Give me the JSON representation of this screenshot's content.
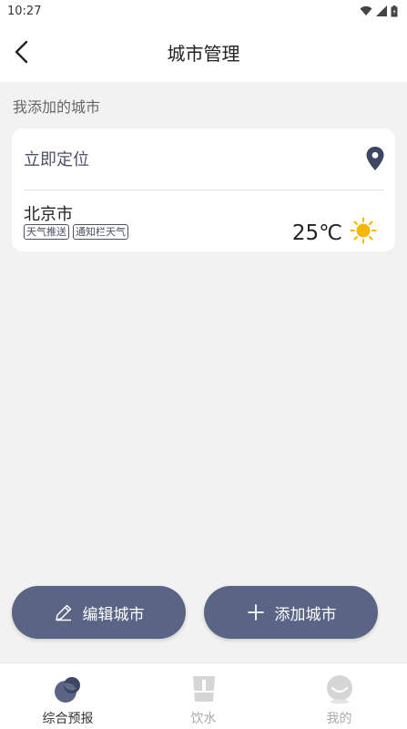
{
  "status": {
    "time": "10:27"
  },
  "header": {
    "title": "城市管理"
  },
  "section_label": "我添加的城市",
  "locate": {
    "label": "立即定位"
  },
  "city": {
    "name": "北京市",
    "tags": [
      "天气推送",
      "通知栏天气"
    ],
    "temperature": "25℃"
  },
  "actions": {
    "edit_label": "编辑城市",
    "add_label": "添加城市"
  },
  "tabs": [
    {
      "label": "综合预报",
      "icon": "forecast-icon",
      "active": true
    },
    {
      "label": "饮水",
      "icon": "water-icon",
      "active": false
    },
    {
      "label": "我的",
      "icon": "profile-icon",
      "active": false
    }
  ],
  "colors": {
    "accent": "#5a6585",
    "sun": "#f5b800",
    "background": "#f2f2f2"
  }
}
